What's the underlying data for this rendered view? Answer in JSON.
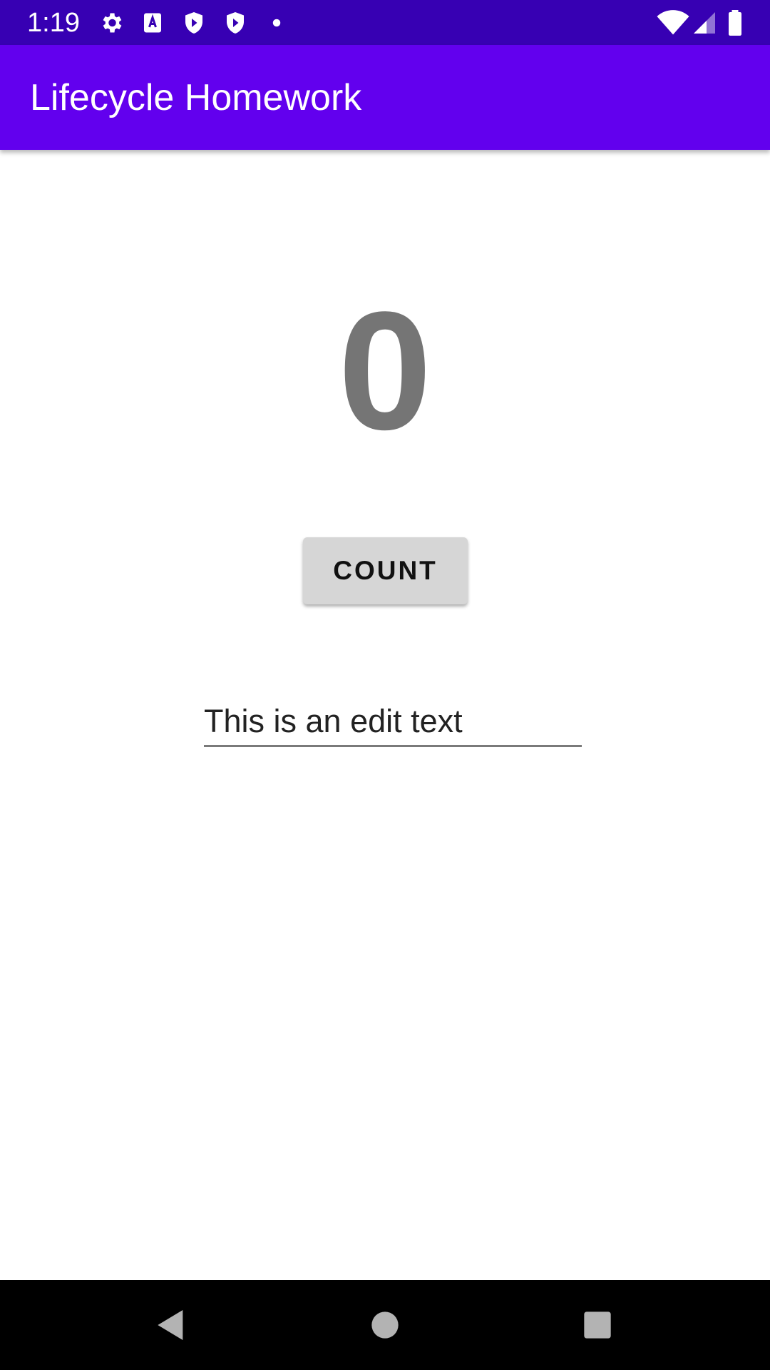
{
  "status_bar": {
    "time": "1:19",
    "icons": [
      "settings-icon",
      "accessibility-a-icon",
      "play-protect-icon",
      "play-protect-icon",
      "dot-icon",
      "wifi-icon",
      "signal-icon",
      "battery-icon"
    ]
  },
  "app_bar": {
    "title": "Lifecycle Homework",
    "color": "#6200ee"
  },
  "main": {
    "count_value": "0",
    "count_button_label": "COUNT",
    "edit_text_value": "This is an edit text"
  },
  "nav_bar": {
    "buttons": [
      "back-icon",
      "home-icon",
      "recents-icon"
    ]
  },
  "colors": {
    "status_bar": "#3700b3",
    "primary": "#6200ee",
    "count_text": "#757575",
    "button_bg": "#d6d6d6"
  }
}
